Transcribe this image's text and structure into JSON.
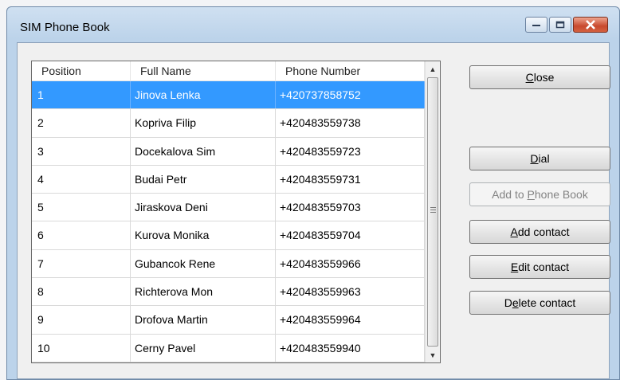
{
  "window": {
    "title": "SIM Phone Book"
  },
  "table": {
    "columns": [
      "Position",
      "Full Name",
      "Phone Number"
    ],
    "rows": [
      {
        "position": "1",
        "name": "Jinova Lenka",
        "phone": "+420737858752"
      },
      {
        "position": "2",
        "name": "Kopriva Filip",
        "phone": "+420483559738"
      },
      {
        "position": "3",
        "name": "Docekalova Sim",
        "phone": "+420483559723"
      },
      {
        "position": "4",
        "name": "Budai Petr",
        "phone": "+420483559731"
      },
      {
        "position": "5",
        "name": "Jiraskova Deni",
        "phone": "+420483559703"
      },
      {
        "position": "6",
        "name": "Kurova Monika",
        "phone": "+420483559704"
      },
      {
        "position": "7",
        "name": "Gubancok Rene",
        "phone": "+420483559966"
      },
      {
        "position": "8",
        "name": "Richterova Mon",
        "phone": "+420483559963"
      },
      {
        "position": "9",
        "name": "Drofova Martin",
        "phone": "+420483559964"
      },
      {
        "position": "10",
        "name": "Cerny Pavel",
        "phone": "+420483559940"
      }
    ],
    "selected_row": 0
  },
  "buttons": {
    "close": {
      "pre": "",
      "accel": "C",
      "post": "lose"
    },
    "dial": {
      "pre": "",
      "accel": "D",
      "post": "ial"
    },
    "add_to_phone_book": {
      "pre": "Add to ",
      "accel": "P",
      "post": "hone Book"
    },
    "add_contact": {
      "pre": "",
      "accel": "A",
      "post": "dd contact"
    },
    "edit_contact": {
      "pre": "",
      "accel": "E",
      "post": "dit contact"
    },
    "delete_contact": {
      "pre": "D",
      "accel": "e",
      "post": "lete contact"
    }
  },
  "icons": {
    "minimize": "minimize-icon",
    "maximize": "maximize-icon",
    "close": "close-icon",
    "scroll_up": "arrow-up-icon",
    "scroll_down": "arrow-down-icon"
  }
}
